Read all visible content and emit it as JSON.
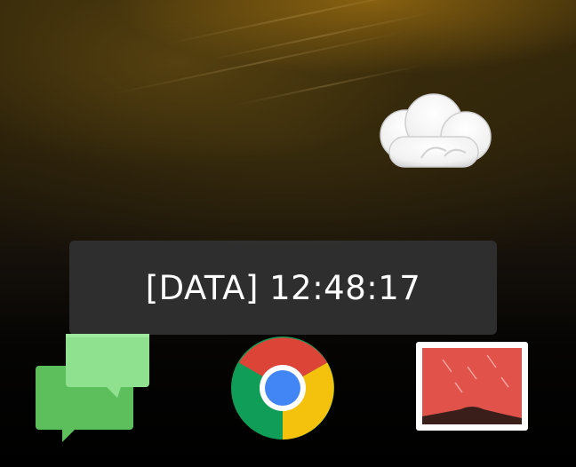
{
  "toast": {
    "text": "[DATA] 12:48:17"
  },
  "weather": {
    "icon": "cloud-icon"
  },
  "dock": {
    "apps": [
      {
        "icon": "messages-icon"
      },
      {
        "icon": "chrome-icon"
      },
      {
        "icon": "gallery-icon"
      }
    ]
  },
  "colors": {
    "toast_bg": "#303030",
    "messages_dark": "#5cbf5c",
    "messages_light": "#8fe08f",
    "chrome_red": "#db4437",
    "chrome_green": "#0f9d58",
    "chrome_yellow": "#f4c20d",
    "chrome_blue": "#4285f4",
    "gallery_red": "#e0524a"
  }
}
